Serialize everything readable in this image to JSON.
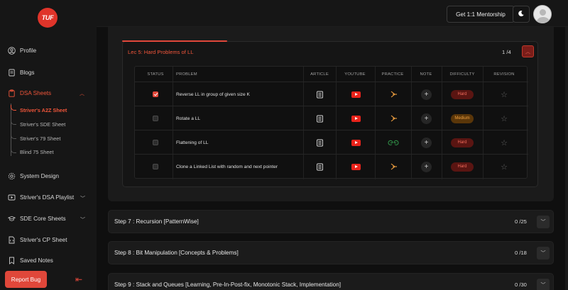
{
  "brand": {
    "logo_text": "TUF"
  },
  "header": {
    "mentorship_label": "Get 1:1 Mentorship"
  },
  "sidebar": {
    "profile": "Profile",
    "blogs": "Blogs",
    "dsa_sheets": "DSA Sheets",
    "sheets": [
      "Striver's A2Z Sheet",
      "Striver's SDE Sheet",
      "Striver's 79 Sheet",
      "Blind 75 Sheet"
    ],
    "system_design": "System Design",
    "dsa_playlist": "Striver's DSA Playlist",
    "sde_core": "SDE Core Sheets",
    "cp_sheet": "Striver's CP Sheet",
    "saved_notes": "Saved Notes",
    "report_bug": "Report Bug"
  },
  "lecture": {
    "title": "Lec 5: Hard Problems of LL",
    "count": "1 /4",
    "columns": [
      "STATUS",
      "PROBLEM",
      "ARTICLE",
      "YOUTUBE",
      "PRACTICE",
      "NOTE",
      "DIFFICULTY",
      "REVISION"
    ],
    "rows": [
      {
        "done": true,
        "problem": "Reverse LL in group of given size K",
        "difficulty": "Hard",
        "level": "hard",
        "practice_icon": "codestudio-icon"
      },
      {
        "done": false,
        "problem": "Rotate a LL",
        "difficulty": "Medium",
        "level": "medium",
        "practice_icon": "codestudio-icon"
      },
      {
        "done": false,
        "problem": "Flattening of LL",
        "difficulty": "Hard",
        "level": "hard",
        "practice_icon": "gfg-icon"
      },
      {
        "done": false,
        "problem": "Clone a Linked List with random and next pointer",
        "difficulty": "Hard",
        "level": "hard",
        "practice_icon": "codestudio-icon"
      }
    ]
  },
  "steps": [
    {
      "title": "Step 7 : Recursion [PatternWise]",
      "count": "0 /25"
    },
    {
      "title": "Step 8 : Bit Manipulation [Concepts & Problems]",
      "count": "0 /18"
    },
    {
      "title": "Step 9 : Stack and Queues [Learning, Pre-In-Post-fix, Monotonic Stack, Implementation]",
      "count": "0 /30"
    }
  ],
  "colors": {
    "accent": "#e0473a",
    "hard": "#f06b5c",
    "medium": "#f0a040",
    "gfg": "#2f8d46",
    "youtube": "#e8231b"
  }
}
